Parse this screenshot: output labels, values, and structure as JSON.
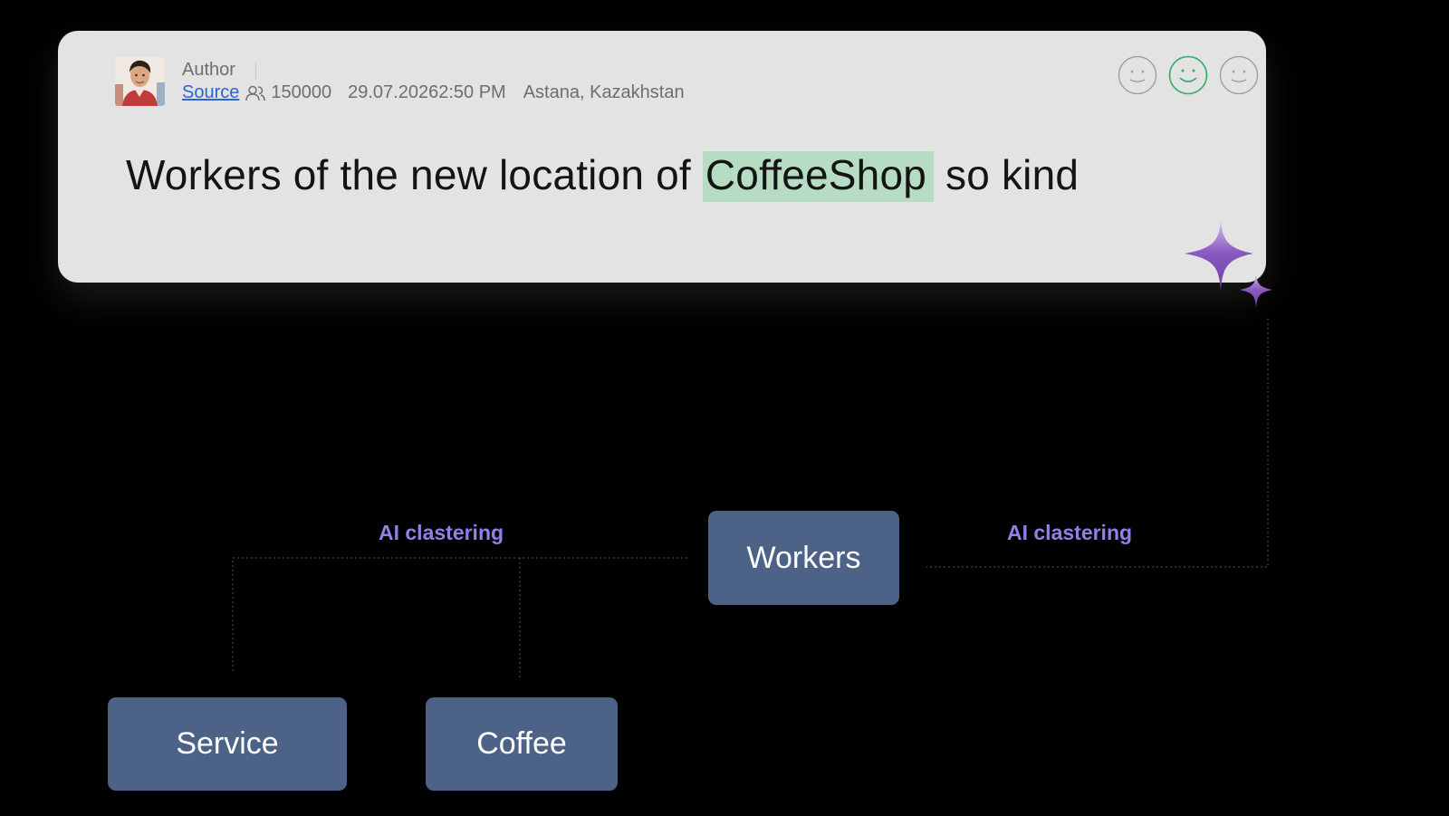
{
  "post": {
    "author": "Author",
    "source": "Source",
    "followers": "150000",
    "date": "29.07.20262:50 PM",
    "location": "Astana, Kazakhstan",
    "text_before": "Workers of the new location of ",
    "text_highlight": "CoffeeShop",
    "text_after": " so kind",
    "highlight_color": "#b7dcc4",
    "sentiment_selected": "positive",
    "sentiment_selected_color": "#2fae66"
  },
  "diagram": {
    "nodes": {
      "workers": "Workers",
      "service": "Service",
      "coffee": "Coffee"
    },
    "edge_labels": {
      "left": "AI clastering",
      "right": "AI clastering"
    },
    "node_color": "#4c6286",
    "label_color": "#8f82e6",
    "sparkle_color": "#8a5bc0"
  }
}
